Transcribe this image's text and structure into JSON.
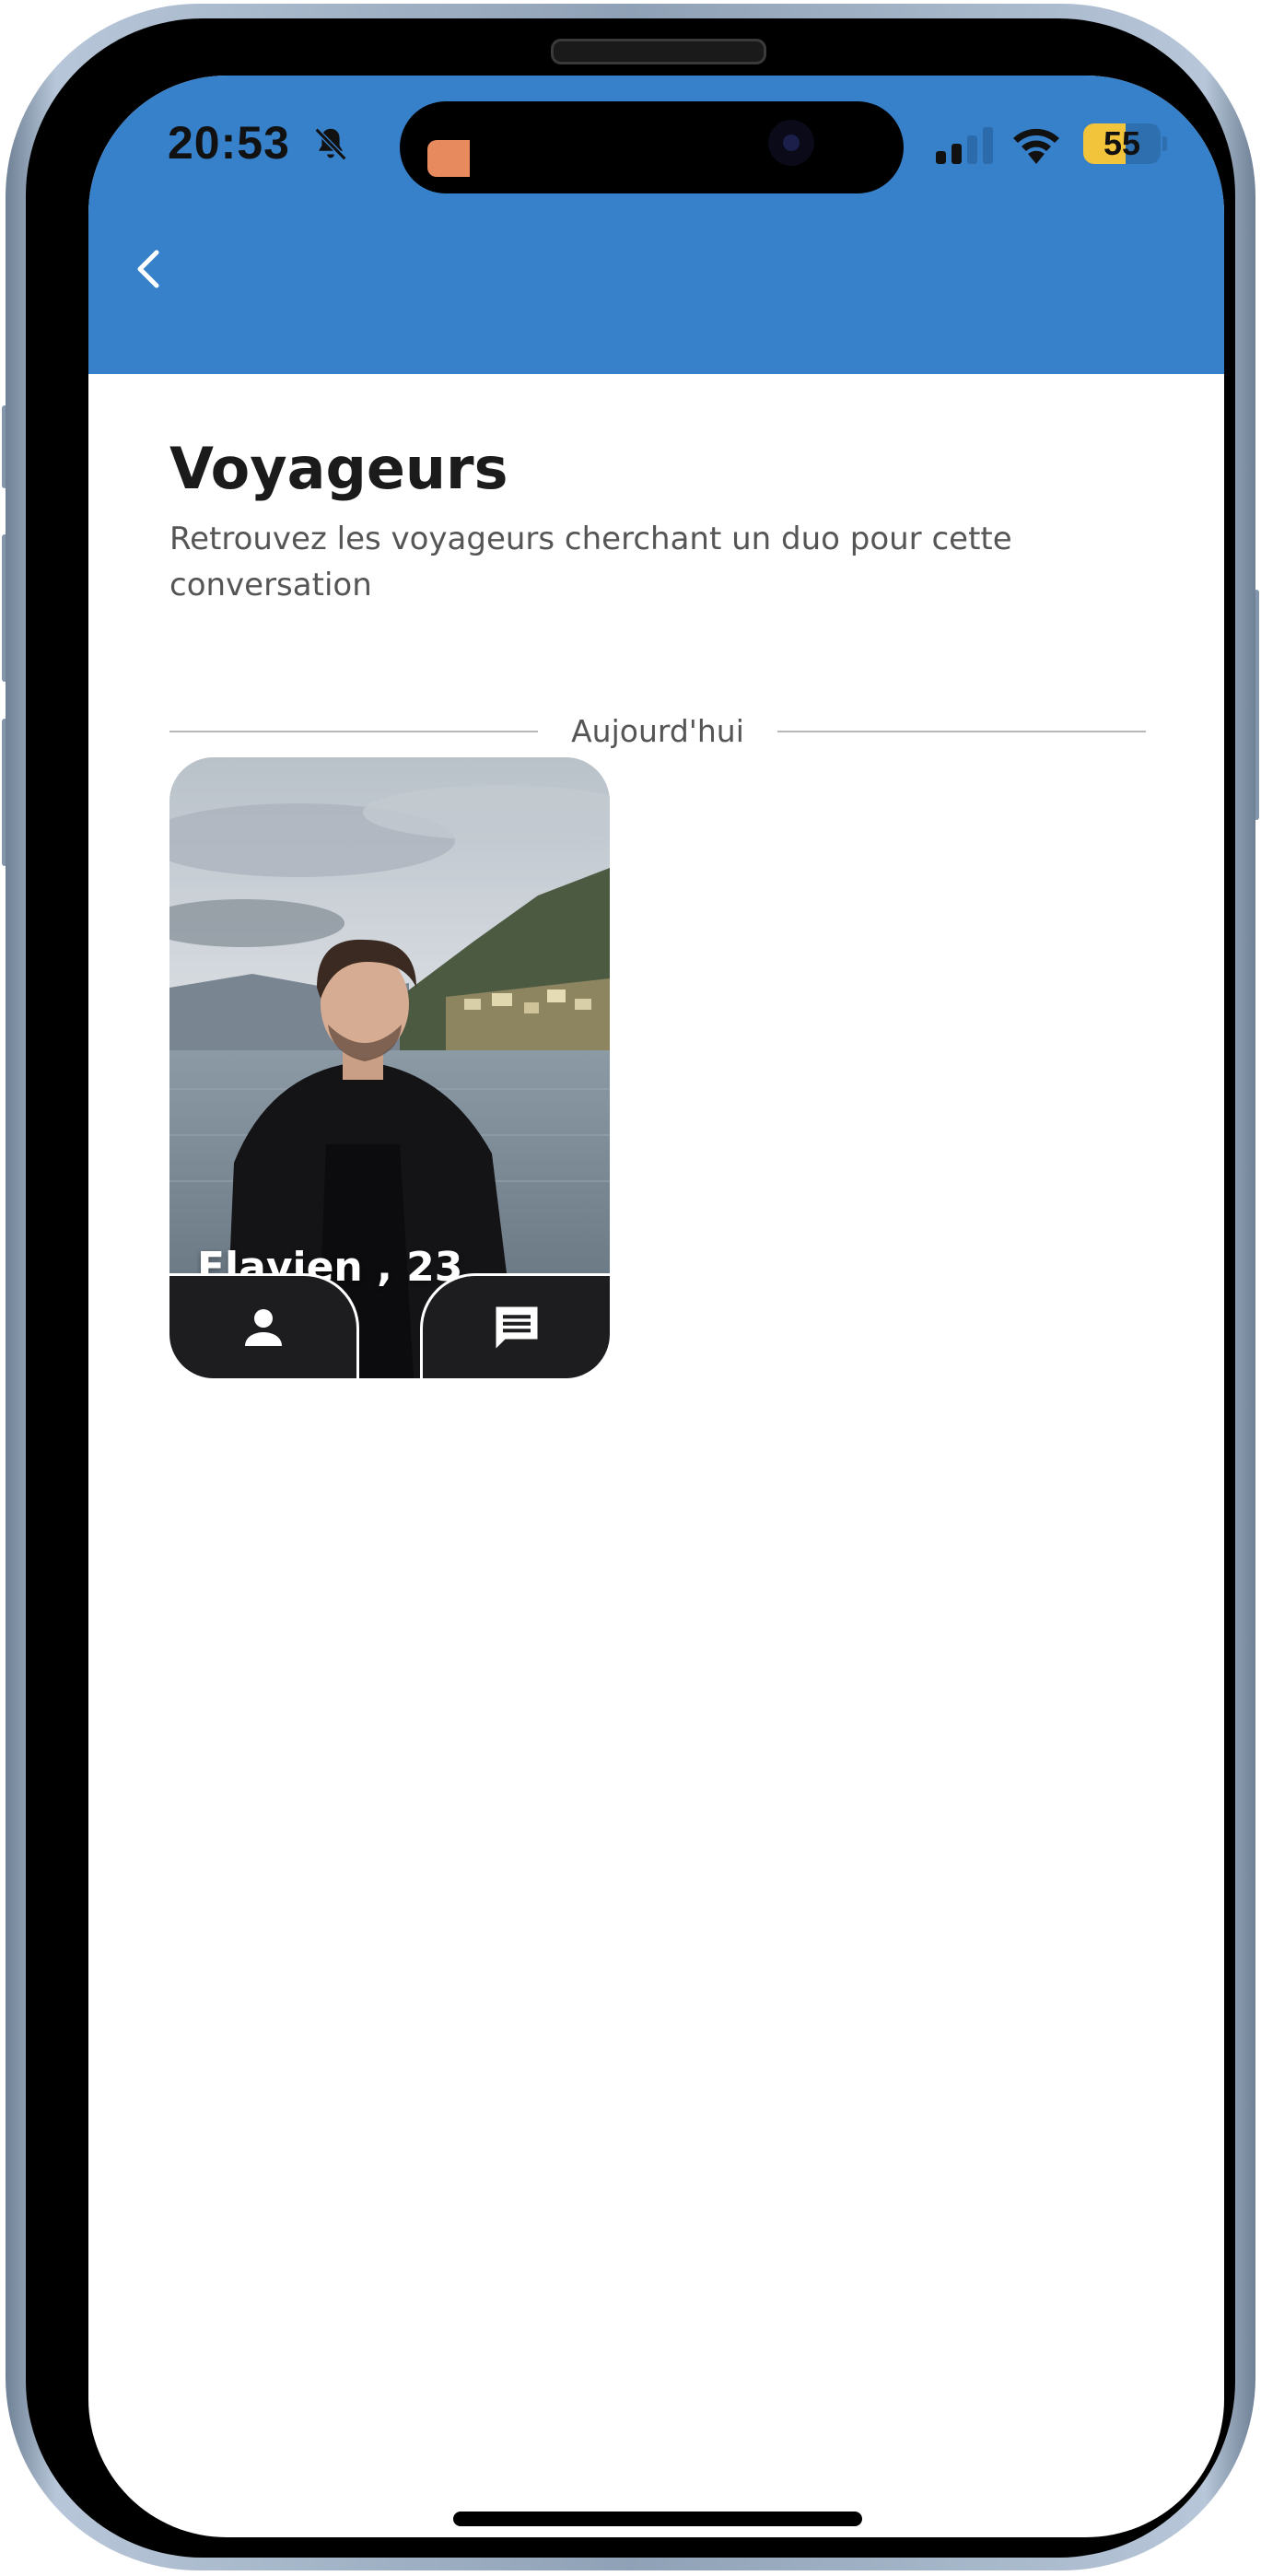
{
  "status_bar": {
    "time": "20:53",
    "battery_level": "55",
    "battery_fraction": 0.55
  },
  "header": {
    "back_icon": "chevron-left-icon",
    "background_color": "#3781cb"
  },
  "content": {
    "title": "Voyageurs",
    "subtitle": "Retrouvez les voyageurs cherchant un duo pour cette conversation",
    "section_label": "Aujourd'hui"
  },
  "travelers": [
    {
      "name_age": "Flavien , 23",
      "profile_icon": "person-icon",
      "message_icon": "message-icon"
    }
  ],
  "colors": {
    "accent": "#3781cb",
    "battery": "#f2c43b",
    "title_text": "#1b1b1b",
    "muted_text": "#555555"
  }
}
